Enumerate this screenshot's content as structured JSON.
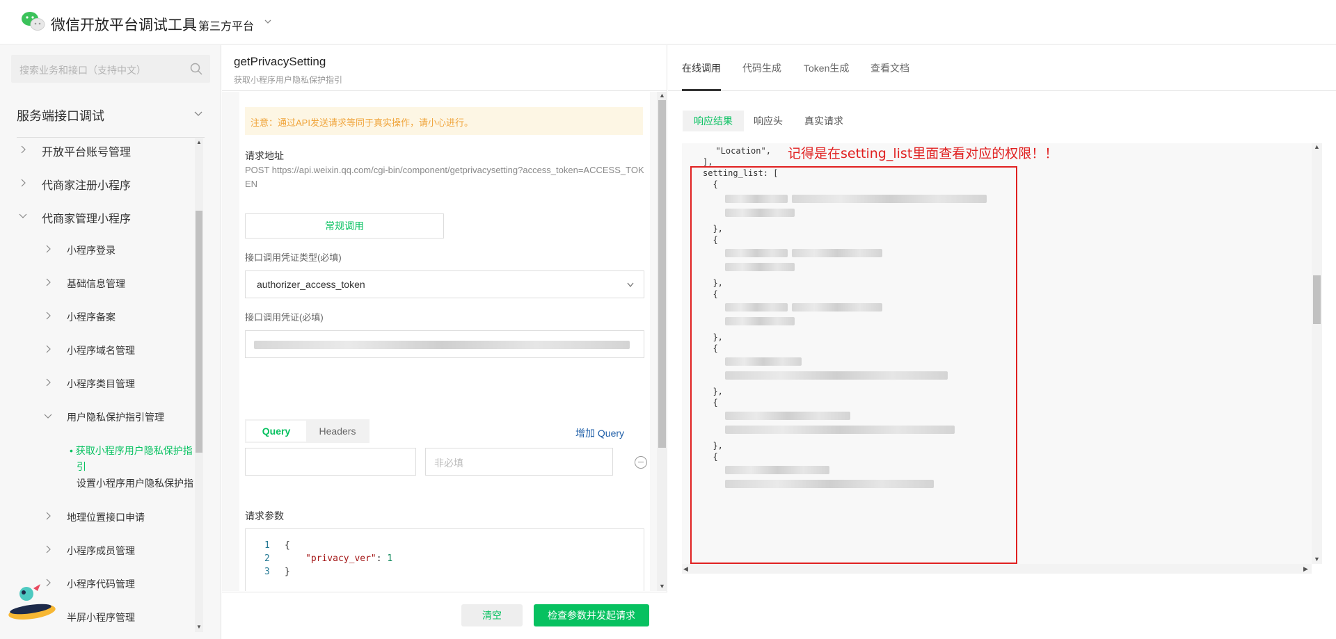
{
  "header": {
    "title": "微信开放平台调试工具",
    "separator": "·",
    "subtitle": "第三方平台"
  },
  "sidebar": {
    "search_placeholder": "搜索业务和接口（支持中文）",
    "section_title": "服务端接口调试",
    "items": [
      {
        "label": "开放平台账号管理",
        "level": 1,
        "expanded": false
      },
      {
        "label": "代商家注册小程序",
        "level": 1,
        "expanded": false
      },
      {
        "label": "代商家管理小程序",
        "level": 1,
        "expanded": true
      },
      {
        "label": "小程序登录",
        "level": 2,
        "expanded": false
      },
      {
        "label": "基础信息管理",
        "level": 2,
        "expanded": false
      },
      {
        "label": "小程序备案",
        "level": 2,
        "expanded": false
      },
      {
        "label": "小程序域名管理",
        "level": 2,
        "expanded": false
      },
      {
        "label": "小程序类目管理",
        "level": 2,
        "expanded": false
      },
      {
        "label": "用户隐私保护指引管理",
        "level": 2,
        "expanded": true
      },
      {
        "label": "获取小程序用户隐私保护指",
        "label2": "引",
        "level": 3,
        "active": true
      },
      {
        "label": "设置小程序用户隐私保护指",
        "label2": "引",
        "level": 3,
        "active": false
      },
      {
        "label": "地理位置接口申请",
        "level": 2,
        "expanded": false
      },
      {
        "label": "小程序成员管理",
        "level": 2,
        "expanded": false
      },
      {
        "label": "小程序代码管理",
        "level": 2,
        "expanded": false
      },
      {
        "label": "半屏小程序管理",
        "level": 2,
        "expanded": false
      }
    ]
  },
  "middle": {
    "api_name": "getPrivacySetting",
    "api_desc": "获取小程序用户隐私保护指引",
    "warning": "注意：通过API发送请求等同于真实操作，请小心进行。",
    "request_url_label": "请求地址",
    "request_url": "POST https://api.weixin.qq.com/cgi-bin/component/getprivacysetting?access_token=ACCESS_TOKEN",
    "call_mode_button": "常规调用",
    "credential_type_label": "接口调用凭证类型(必填)",
    "credential_type_value": "authorizer_access_token",
    "credential_label": "接口调用凭证(必填)",
    "tab_query": "Query",
    "tab_headers": "Headers",
    "add_query": "增加 Query",
    "query_value_placeholder": "非必填",
    "params_label": "请求参数",
    "code_lines": [
      {
        "num": "1",
        "text": "{"
      },
      {
        "num": "2",
        "key": "\"privacy_ver\"",
        "colon": ": ",
        "value": "1"
      },
      {
        "num": "3",
        "text": "}"
      }
    ],
    "clear_button": "清空",
    "submit_button": "检查参数并发起请求"
  },
  "right": {
    "tabs": [
      "在线调用",
      "代码生成",
      "Token生成",
      "查看文档"
    ],
    "active_tab": "在线调用",
    "subtabs": [
      "响应结果",
      "响应头",
      "真实请求"
    ],
    "active_subtab": "响应结果",
    "response_lines": [
      {
        "text": "  \"Location\","
      },
      {
        "text": "],"
      },
      {
        "text": "setting_list: ["
      },
      {
        "text": "  {"
      },
      {
        "text": "  },"
      },
      {
        "text": "  {"
      },
      {
        "text": "  },"
      },
      {
        "text": "  {"
      },
      {
        "text": "  },"
      },
      {
        "text": "  {"
      },
      {
        "text": "  },"
      },
      {
        "text": "  {"
      },
      {
        "text": "  },"
      },
      {
        "text": "  {"
      }
    ],
    "annotation": "记得是在setting_list里面查看对应的权限！！",
    "annotation_color": "#e02020"
  },
  "colors": {
    "accent": "#07c160",
    "warning_bg": "#fdf6e4",
    "warning_text": "#f0a43a",
    "link": "#1f5fa8"
  }
}
